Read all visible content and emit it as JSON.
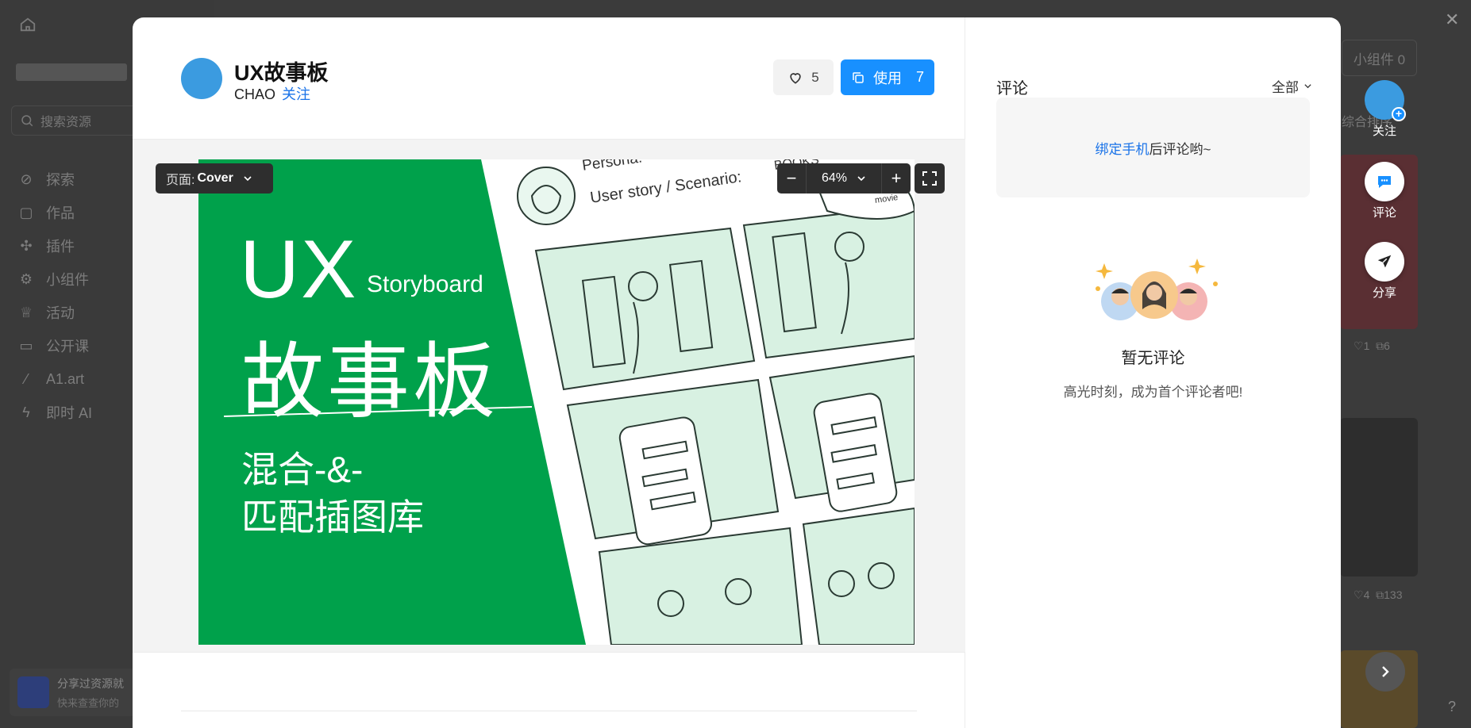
{
  "background": {
    "search_placeholder": "搜索资源",
    "nav": [
      {
        "label": "探索",
        "icon": "planet-icon"
      },
      {
        "label": "作品",
        "icon": "document-icon"
      },
      {
        "label": "插件",
        "icon": "puzzle-icon"
      },
      {
        "label": "小组件",
        "icon": "gear-icon"
      },
      {
        "label": "活动",
        "icon": "trophy-icon"
      },
      {
        "label": "公开课",
        "icon": "book-icon"
      },
      {
        "label": "A1.art",
        "icon": "a1-icon"
      },
      {
        "label": "即时 AI",
        "icon": "lightning-icon"
      }
    ],
    "banner_title": "分享过资源就",
    "banner_sub": "快来查查你的",
    "widget_button": "小组件 0",
    "sort_label": "综合排序",
    "stats": [
      {
        "likes": "1",
        "uses": "6"
      },
      {
        "likes": "4",
        "uses": "133"
      }
    ]
  },
  "header": {
    "title": "UX故事板",
    "author": "CHAO",
    "follow": "关注",
    "likes": "5",
    "use_label": "使用",
    "use_count": "7"
  },
  "preview": {
    "page_prefix": "页面:",
    "page_name": "Cover",
    "zoom": "64%",
    "cover": {
      "title_en": "UX",
      "subtitle_en": "Storyboard",
      "title_cn": "故事板",
      "line1": "混合-&-",
      "line2": "匹配插图库",
      "persona": "Persona:",
      "scenario": "User story / Scenario:",
      "books": "BOOKS",
      "movie": "movie"
    }
  },
  "comments": {
    "title": "评论",
    "filter": "全部",
    "bind_link": "绑定手机",
    "bind_suffix": "后评论哟~",
    "empty_title": "暂无评论",
    "empty_sub": "高光时刻，成为首个评论者吧!"
  },
  "floating": {
    "follow": "关注",
    "comment": "评论",
    "share": "分享"
  },
  "colors": {
    "accent": "#1890ff",
    "cover_green": "#00a14b",
    "illustration_mint": "#d8f1e2"
  }
}
